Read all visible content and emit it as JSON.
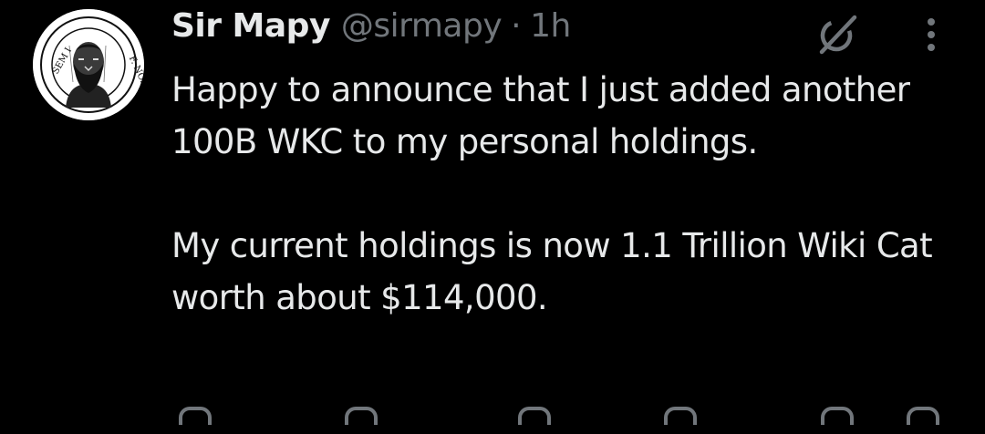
{
  "tweet": {
    "author": {
      "display_name": "Sir Mapy",
      "handle": "@sirmapy",
      "avatar_text_left": "SEM I",
      "avatar_text_right": "F. NO."
    },
    "separator": "·",
    "time": "1h",
    "text_paragraphs": [
      "Happy to announce that I just added another 100B WKC to my personal holdings.",
      "My current holdings is now 1.1 Trillion Wiki Cat worth about $114,000."
    ]
  },
  "icons": {
    "grok": "grok-icon",
    "more": "more-vertical-icon",
    "reply": "reply-icon",
    "retweet": "retweet-icon",
    "like": "heart-icon",
    "views": "views-icon",
    "bookmark": "bookmark-icon",
    "share": "share-icon"
  },
  "colors": {
    "background": "#000000",
    "primary_text": "#e7e9ea",
    "secondary_text": "#71767b"
  }
}
